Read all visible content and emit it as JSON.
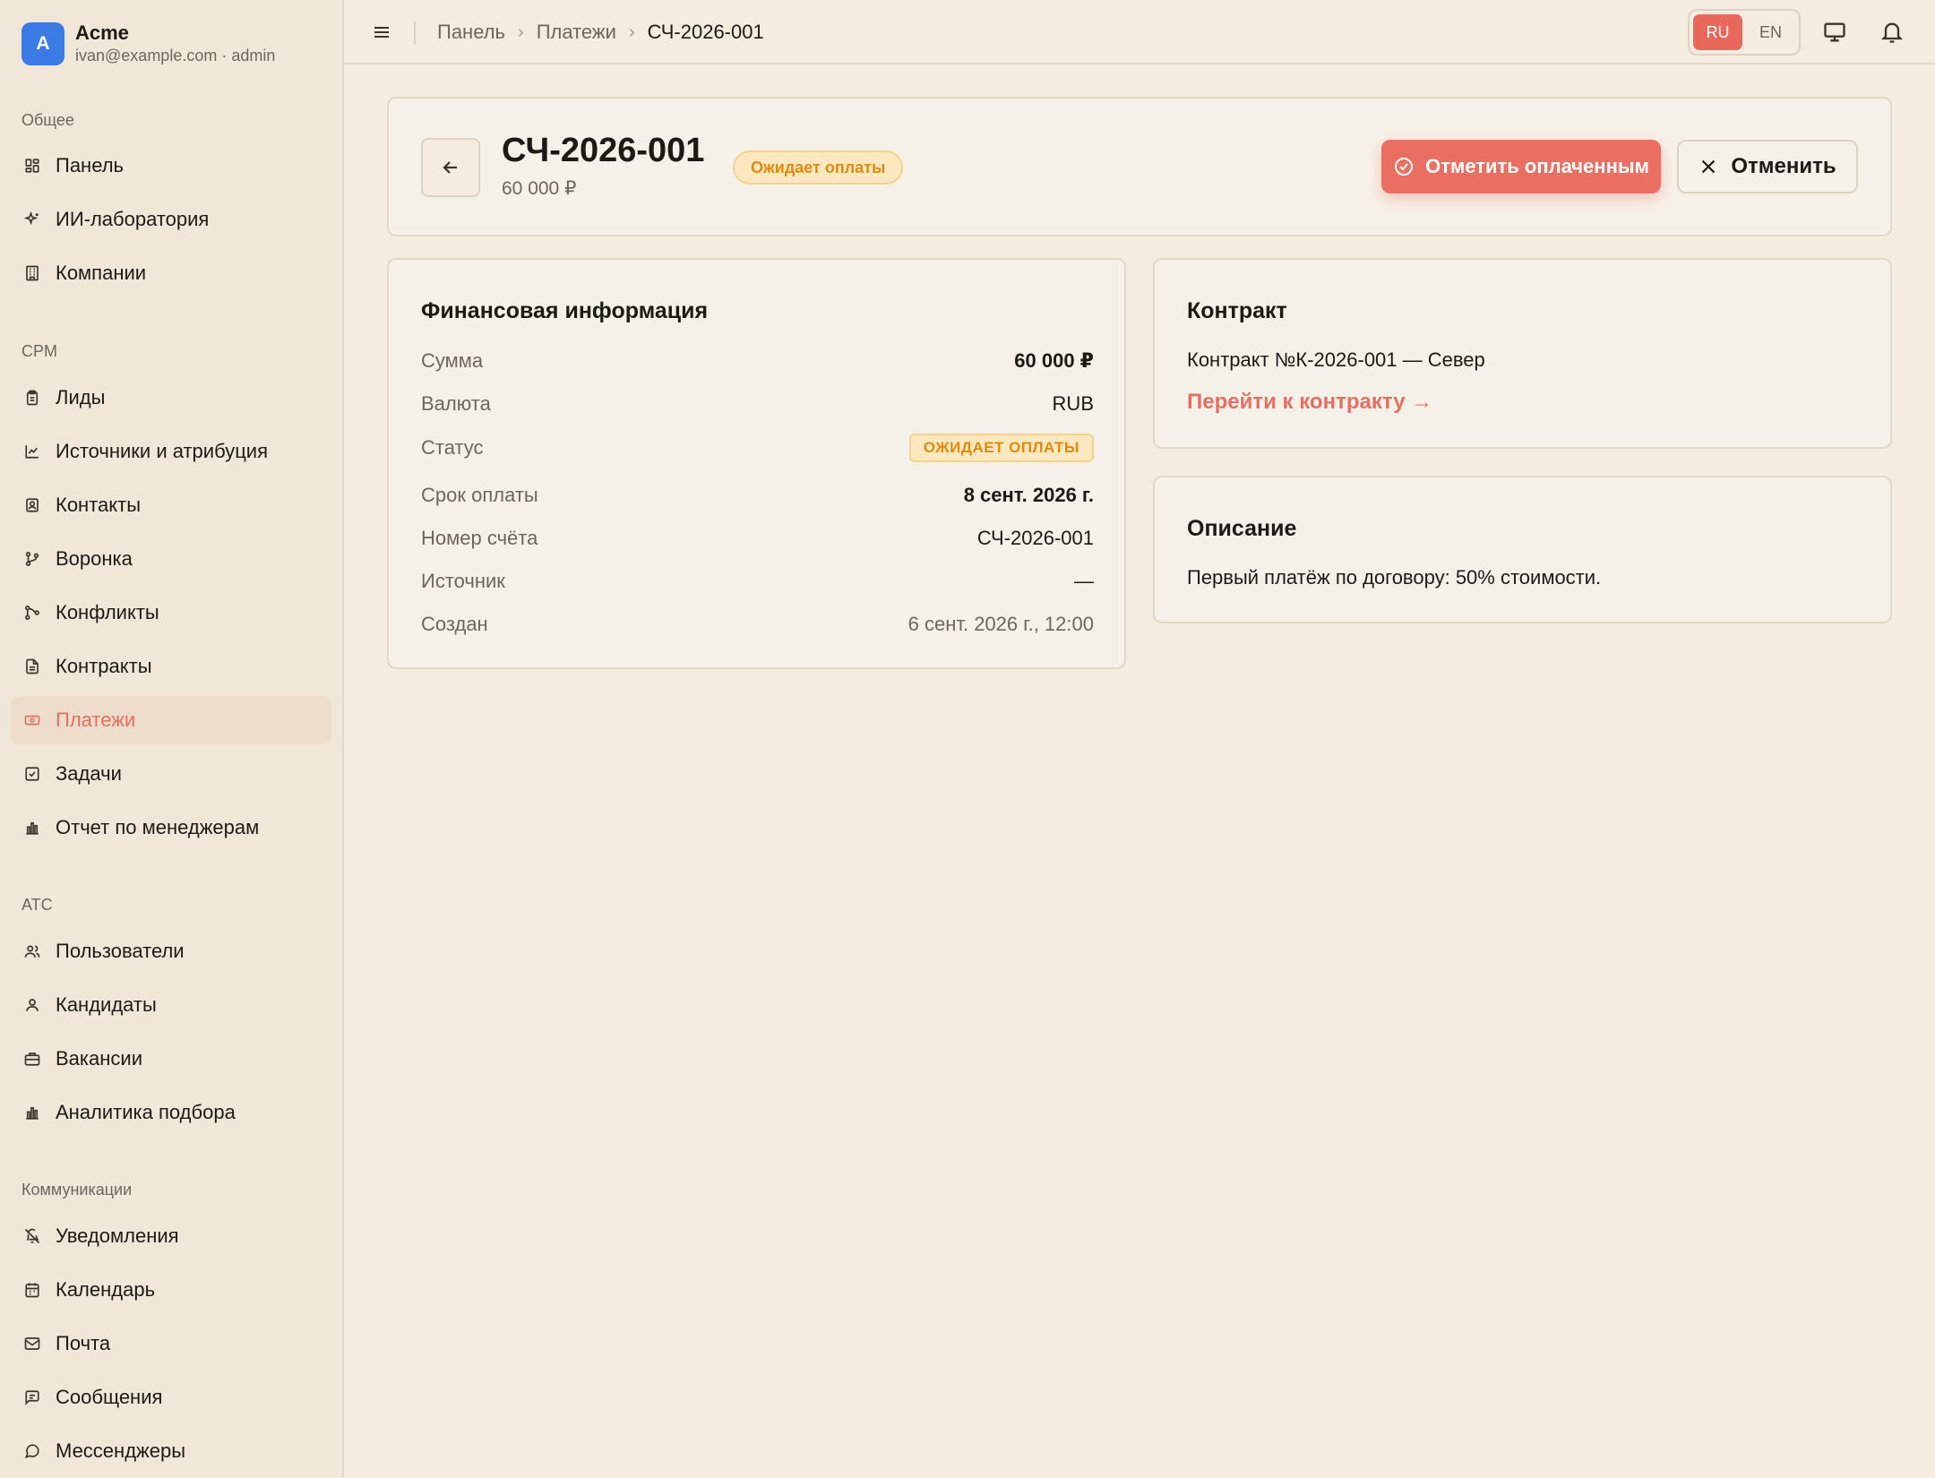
{
  "brand": {
    "initial": "A",
    "name": "Acme",
    "subtitle": "ivan@example.com · admin"
  },
  "sidebar": {
    "sections": [
      {
        "label": "Общее"
      },
      {
        "label": "CPM"
      },
      {
        "label": "АТС"
      },
      {
        "label": "Коммуникации"
      }
    ],
    "items": [
      {
        "label": "Панель",
        "icon": "grid-icon"
      },
      {
        "label": "ИИ-лаборатория",
        "icon": "sparkles-icon"
      },
      {
        "label": "Компании",
        "icon": "building-icon"
      },
      {
        "label": "Лиды",
        "icon": "clipboard-icon"
      },
      {
        "label": "Источники и атрибуция",
        "icon": "chart-line-icon"
      },
      {
        "label": "Контакты",
        "icon": "contact-card-icon"
      },
      {
        "label": "Воронка",
        "icon": "git-branch-icon"
      },
      {
        "label": "Конфликты",
        "icon": "git-merge-icon"
      },
      {
        "label": "Контракты",
        "icon": "file-text-icon"
      },
      {
        "label": "Платежи",
        "icon": "banknote-icon",
        "active": true
      },
      {
        "label": "Задачи",
        "icon": "checkbox-icon"
      },
      {
        "label": "Отчет по менеджерам",
        "icon": "bar-chart-icon"
      },
      {
        "label": "Пользователи",
        "icon": "users-icon"
      },
      {
        "label": "Кандидаты",
        "icon": "user-icon"
      },
      {
        "label": "Вакансии",
        "icon": "briefcase-icon"
      },
      {
        "label": "Аналитика подбора",
        "icon": "bar-chart-icon"
      },
      {
        "label": "Уведомления",
        "icon": "bell-off-icon"
      },
      {
        "label": "Календарь",
        "icon": "calendar-icon"
      },
      {
        "label": "Почта",
        "icon": "mail-icon"
      },
      {
        "label": "Сообщения",
        "icon": "message-square-icon"
      },
      {
        "label": "Мессенджеры",
        "icon": "message-circle-icon"
      }
    ]
  },
  "topbar": {
    "breadcrumb": [
      "Панель",
      "Платежи",
      "СЧ-2026-001"
    ],
    "languages": [
      "RU",
      "EN"
    ],
    "active_language": "RU"
  },
  "invoice": {
    "number": "СЧ-2026-001",
    "amount": "60 000 ₽",
    "status": "Ожидает оплаты",
    "mark_paid_label": "Отметить оплаченным",
    "cancel_label": "Отменить"
  },
  "finance": {
    "title": "Финансовая информация",
    "rows": [
      {
        "label": "Сумма",
        "value": "60 000 ₽"
      },
      {
        "label": "Валюта",
        "value": "RUB"
      },
      {
        "label": "Статус",
        "value": "ОЖИДАЕТ ОПЛАТЫ"
      },
      {
        "label": "Срок оплаты",
        "value": "8 сент. 2026 г."
      },
      {
        "label": "Номер счёта",
        "value": "СЧ-2026-001"
      },
      {
        "label": "Источник",
        "value": "—"
      },
      {
        "label": "Создан",
        "value": "6 сент. 2026 г., 12:00"
      }
    ]
  },
  "contract": {
    "title": "Контракт",
    "text": "Контракт №К-2026-001 — Север",
    "link": "Перейти к контракту →"
  },
  "description": {
    "title": "Описание",
    "text": "Первый платёж по договору: 50% стоимости."
  },
  "colors": {
    "accent": "#e9685c",
    "background": "#f3ecdf",
    "sidebar": "#f0e7d8",
    "warning": "#e08a0b",
    "brand_blue": "#3a7be6"
  }
}
